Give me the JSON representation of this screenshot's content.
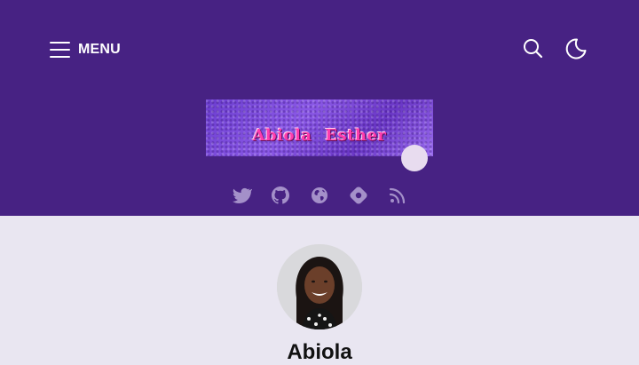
{
  "header": {
    "menu_label": "MENU",
    "banner_text": "Abiola Esther",
    "icons": {
      "menu": "hamburger-icon",
      "search": "search-icon",
      "theme": "moon-icon"
    },
    "socials": [
      {
        "name": "twitter",
        "icon": "twitter-icon"
      },
      {
        "name": "github",
        "icon": "github-icon"
      },
      {
        "name": "website",
        "icon": "globe-icon"
      },
      {
        "name": "hashnode",
        "icon": "hashnode-icon"
      },
      {
        "name": "rss",
        "icon": "rss-icon"
      }
    ]
  },
  "profile": {
    "name": "Abiola"
  },
  "colors": {
    "header_bg": "#472283",
    "page_bg": "#e9e6f1",
    "banner_text": "#ff3cae",
    "social_icon": "#c6b6e6"
  }
}
